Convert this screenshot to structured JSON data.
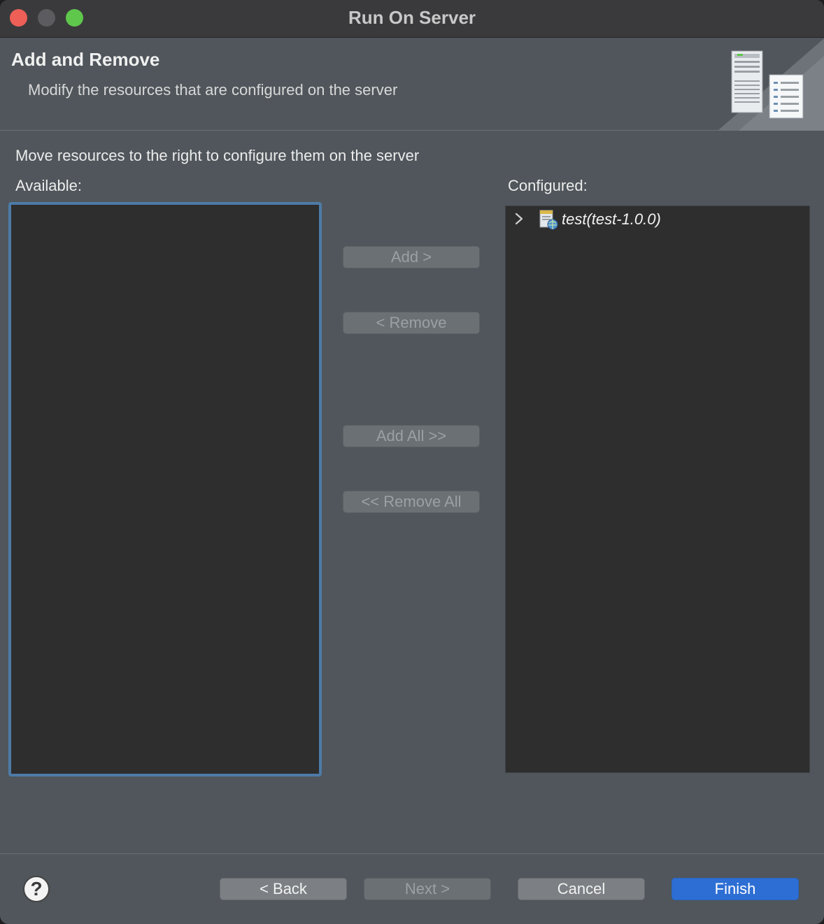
{
  "window": {
    "title": "Run On Server"
  },
  "header": {
    "title": "Add and Remove",
    "description": "Modify the resources that are configured on the server"
  },
  "instruction": "Move resources to the right to configure them on the server",
  "available": {
    "label": "Available:",
    "items": []
  },
  "configured": {
    "label": "Configured:",
    "items": [
      {
        "label": "test(test-1.0.0)",
        "icon": "web-module-icon",
        "expanded": false
      }
    ]
  },
  "actions": {
    "add": "Add >",
    "remove": "< Remove",
    "add_all": "Add All >>",
    "remove_all": "<< Remove All"
  },
  "footer": {
    "help": "?",
    "back": "< Back",
    "next": "Next >",
    "cancel": "Cancel",
    "finish": "Finish"
  },
  "colors": {
    "accent": "#2d6ed4",
    "focus_border": "#4d7ba7",
    "close": "#ee5f57",
    "maximize": "#5fc74c"
  }
}
